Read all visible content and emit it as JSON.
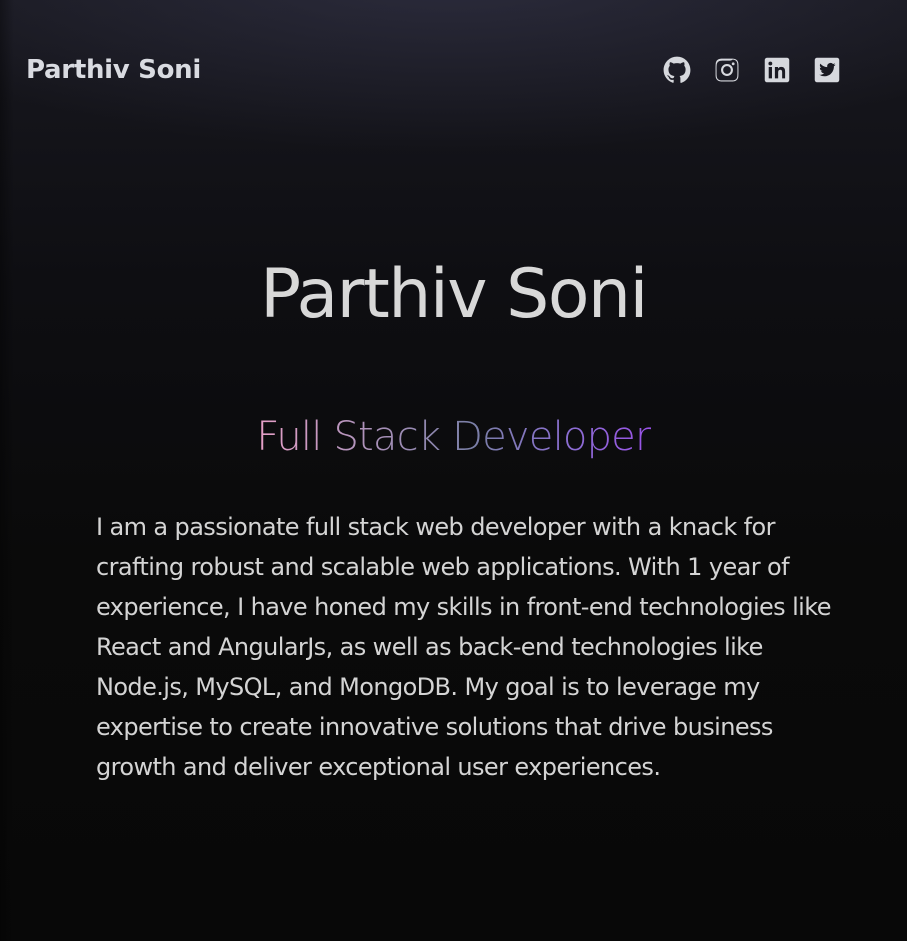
{
  "header": {
    "brand": "Parthiv Soni",
    "socials": [
      {
        "name": "github",
        "icon": "github-icon"
      },
      {
        "name": "instagram",
        "icon": "instagram-icon"
      },
      {
        "name": "linkedin",
        "icon": "linkedin-icon"
      },
      {
        "name": "twitter",
        "icon": "twitter-icon"
      }
    ]
  },
  "hero": {
    "title": "Parthiv Soni",
    "subtitle": "Full Stack Developer",
    "subtitle_gradient": [
      "#e8a0c8",
      "#7a7fa6",
      "#9a52e8"
    ],
    "about": "I am a passionate full stack web developer with a knack for crafting robust and scalable web applications. With 1 year of experience, I have honed my skills in front-end technologies like React and AngularJs, as well as back-end technologies like Node.js, MySQL, and MongoDB. My goal is to leverage my expertise to create innovative solutions that drive business growth and deliver exceptional user experiences."
  },
  "colors": {
    "background": "#0a0a0b",
    "text": "#d8d8d8"
  }
}
